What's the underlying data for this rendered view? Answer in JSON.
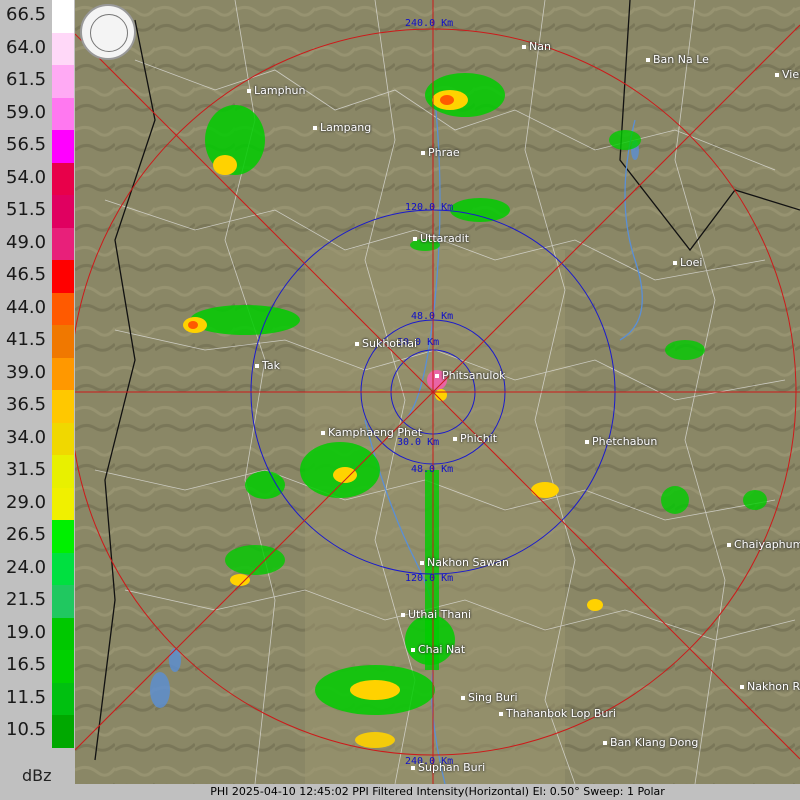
{
  "legend": {
    "unit": "dBz",
    "levels": [
      {
        "label": "66.5",
        "color": "#ffffff"
      },
      {
        "label": "64.0",
        "color": "#ffd8f8"
      },
      {
        "label": "61.5",
        "color": "#ffaaf4"
      },
      {
        "label": "59.0",
        "color": "#ff78f0"
      },
      {
        "label": "56.5",
        "color": "#ff00ff"
      },
      {
        "label": "54.0",
        "color": "#e8004a"
      },
      {
        "label": "51.5",
        "color": "#e00060"
      },
      {
        "label": "49.0",
        "color": "#e8207a"
      },
      {
        "label": "46.5",
        "color": "#ff0000"
      },
      {
        "label": "44.0",
        "color": "#ff5a00"
      },
      {
        "label": "41.5",
        "color": "#f07800"
      },
      {
        "label": "39.0",
        "color": "#ff9800"
      },
      {
        "label": "36.5",
        "color": "#ffc800"
      },
      {
        "label": "34.0",
        "color": "#f0d800"
      },
      {
        "label": "31.5",
        "color": "#e8f000"
      },
      {
        "label": "29.0",
        "color": "#f0f000"
      },
      {
        "label": "26.5",
        "color": "#00f000"
      },
      {
        "label": "24.0",
        "color": "#00e040"
      },
      {
        "label": "21.5",
        "color": "#20c860"
      },
      {
        "label": "19.0",
        "color": "#00c800"
      },
      {
        "label": "16.5",
        "color": "#00d000"
      },
      {
        "label": "11.5",
        "color": "#00c010"
      },
      {
        "label": "10.5",
        "color": "#00a800"
      }
    ]
  },
  "rings": {
    "color_inner": "#1a1acc",
    "color_outer": "#cc1a1a",
    "labels": [
      {
        "id": "r30a",
        "text": "30.0 Km"
      },
      {
        "id": "r30b",
        "text": "30.0 Km"
      },
      {
        "id": "r48a",
        "text": "48.0 Km"
      },
      {
        "id": "r48b",
        "text": "48.0 Km"
      },
      {
        "id": "r120a",
        "text": "120.0 Km"
      },
      {
        "id": "r120b",
        "text": "120.0 Km"
      },
      {
        "id": "r240a",
        "text": "240.0 Km"
      },
      {
        "id": "r240b",
        "text": "240.0 Km"
      }
    ]
  },
  "places": [
    {
      "id": "nan",
      "name": "Nan"
    },
    {
      "id": "ban-na-le",
      "name": "Ban Na Le"
    },
    {
      "id": "vien",
      "name": "Vien"
    },
    {
      "id": "lamphun",
      "name": "Lamphun"
    },
    {
      "id": "lampang",
      "name": "Lampang"
    },
    {
      "id": "phrae",
      "name": "Phrae"
    },
    {
      "id": "uttaradit",
      "name": "Uttaradit"
    },
    {
      "id": "loei",
      "name": "Loei"
    },
    {
      "id": "sukhothai",
      "name": "Sukhothai"
    },
    {
      "id": "phitsanulok",
      "name": "Phitsanulok"
    },
    {
      "id": "tak",
      "name": "Tak"
    },
    {
      "id": "kamphaeng-phet",
      "name": "Kamphaeng Phet"
    },
    {
      "id": "phichit",
      "name": "Phichit"
    },
    {
      "id": "phetchabun",
      "name": "Phetchabun"
    },
    {
      "id": "nakhon-sawan",
      "name": "Nakhon Sawan"
    },
    {
      "id": "chaiyaphum",
      "name": "Chaiyaphum"
    },
    {
      "id": "uthai-thani",
      "name": "Uthai Thani"
    },
    {
      "id": "chai-nat",
      "name": "Chai Nat"
    },
    {
      "id": "sing-buri",
      "name": "Sing Buri"
    },
    {
      "id": "thahanbok",
      "name": "Thahanbok Lop Buri"
    },
    {
      "id": "ban-klang-dong",
      "name": "Ban Klang Dong"
    },
    {
      "id": "nakhon-ratchasima",
      "name": "Nakhon Ra"
    },
    {
      "id": "suphan-buri",
      "name": "Suphan Buri"
    }
  ],
  "status_bar": "PHI 2025-04-10 12:45:02 PPI Filtered Intensity(Horizontal)  El: 0.50°  Sweep: 1 Polar"
}
